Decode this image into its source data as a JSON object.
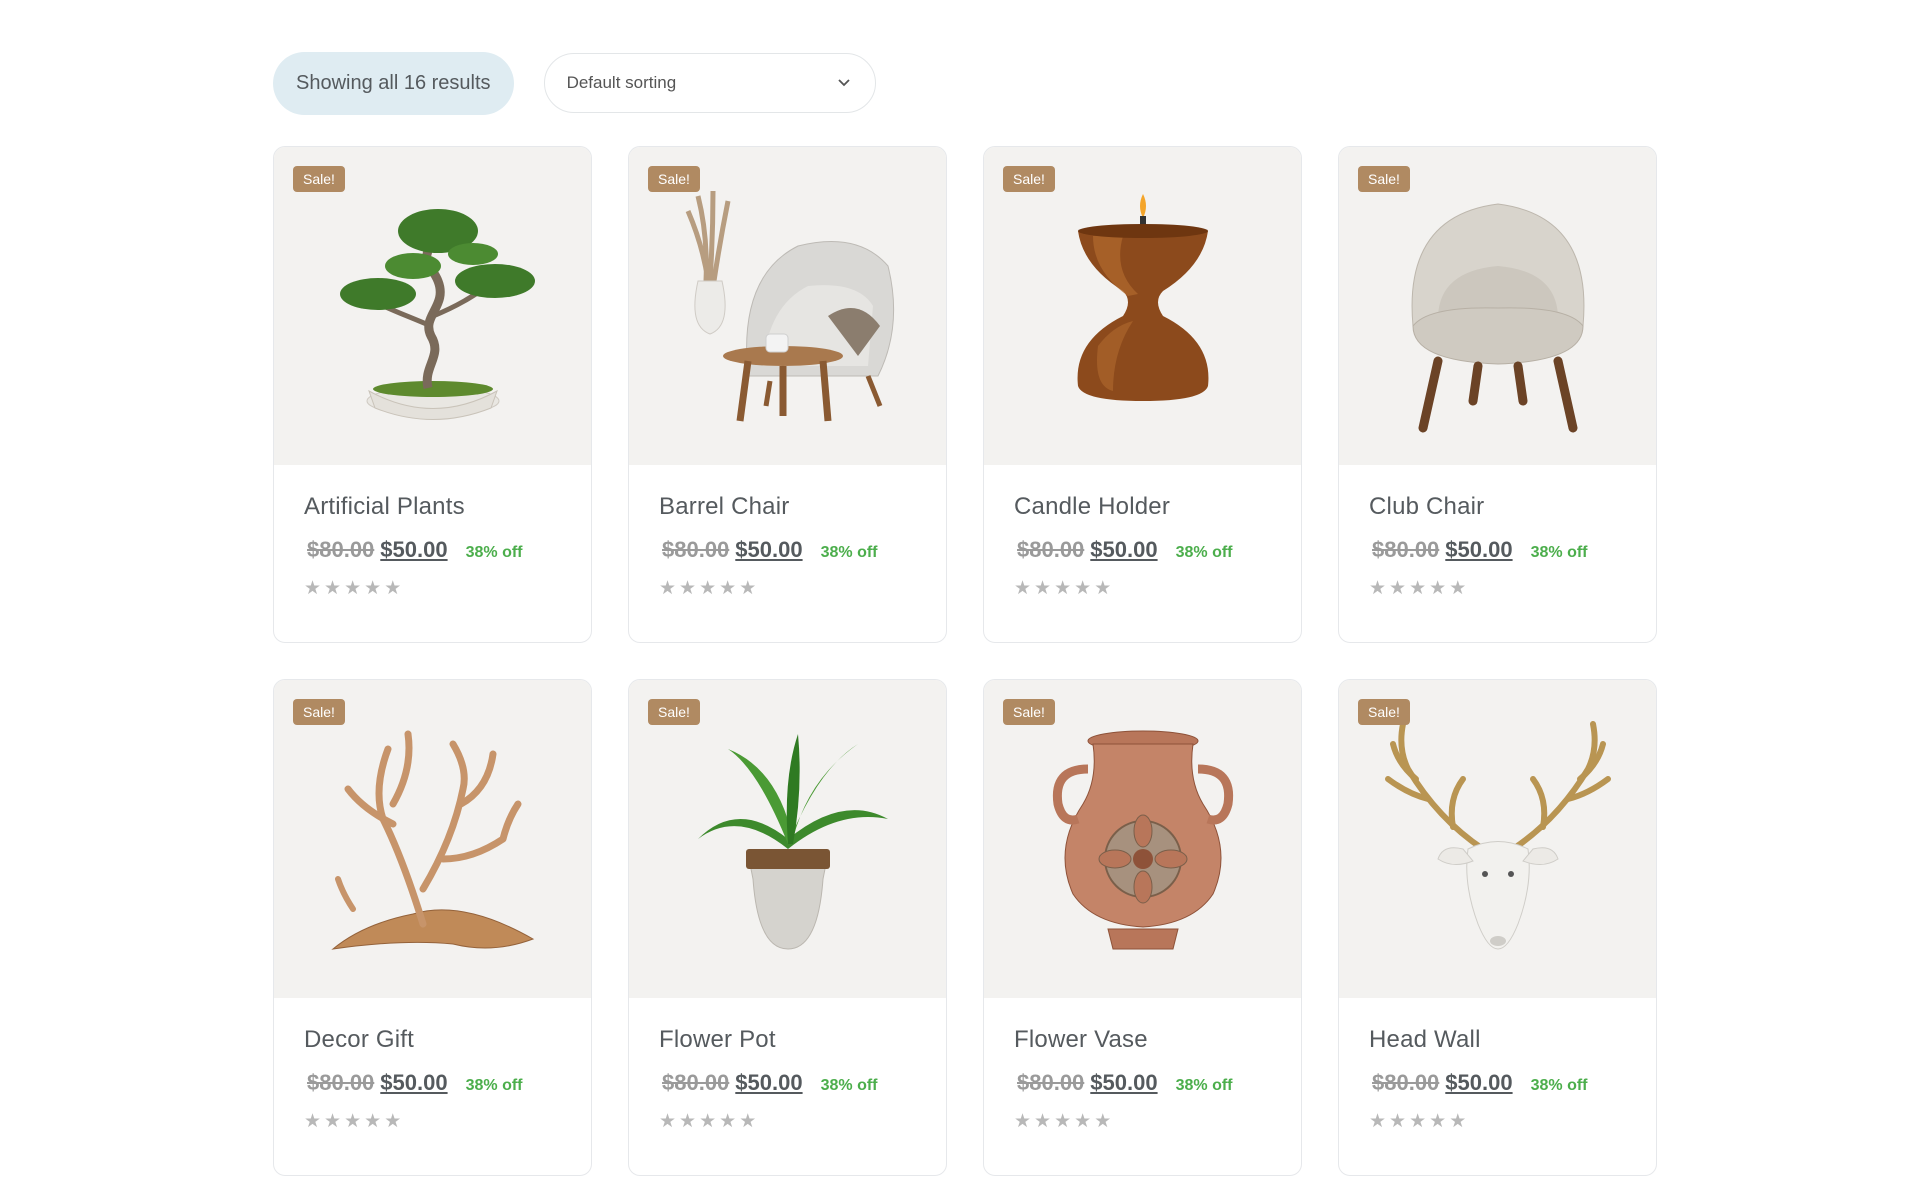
{
  "toolbar": {
    "result_count": "Showing all 16 results",
    "sort_selected": "Default sorting"
  },
  "products": [
    {
      "name": "Artificial Plants",
      "badge": "Sale!",
      "old_price": "$80.00",
      "price": "$50.00",
      "discount": "38% off",
      "rating": 0,
      "image_icon": "bonsai-image"
    },
    {
      "name": "Barrel Chair",
      "badge": "Sale!",
      "old_price": "$80.00",
      "price": "$50.00",
      "discount": "38% off",
      "rating": 0,
      "image_icon": "barrel-chair-image"
    },
    {
      "name": "Candle Holder",
      "badge": "Sale!",
      "old_price": "$80.00",
      "price": "$50.00",
      "discount": "38% off",
      "rating": 0,
      "image_icon": "candle-holder-image"
    },
    {
      "name": "Club Chair",
      "badge": "Sale!",
      "old_price": "$80.00",
      "price": "$50.00",
      "discount": "38% off",
      "rating": 0,
      "image_icon": "club-chair-image"
    },
    {
      "name": "Decor Gift",
      "badge": "Sale!",
      "old_price": "$80.00",
      "price": "$50.00",
      "discount": "38% off",
      "rating": 0,
      "image_icon": "driftwood-image"
    },
    {
      "name": "Flower Pot",
      "badge": "Sale!",
      "old_price": "$80.00",
      "price": "$50.00",
      "discount": "38% off",
      "rating": 0,
      "image_icon": "potted-plant-image"
    },
    {
      "name": "Flower Vase",
      "badge": "Sale!",
      "old_price": "$80.00",
      "price": "$50.00",
      "discount": "38% off",
      "rating": 0,
      "image_icon": "vase-image"
    },
    {
      "name": "Head Wall",
      "badge": "Sale!",
      "old_price": "$80.00",
      "price": "$50.00",
      "discount": "38% off",
      "rating": 0,
      "image_icon": "deer-head-image"
    }
  ],
  "colors": {
    "badge": "#b08a62",
    "discount": "#4cae4c",
    "result_pill": "#dfecf2",
    "media_bg": "#f3f2f0"
  }
}
